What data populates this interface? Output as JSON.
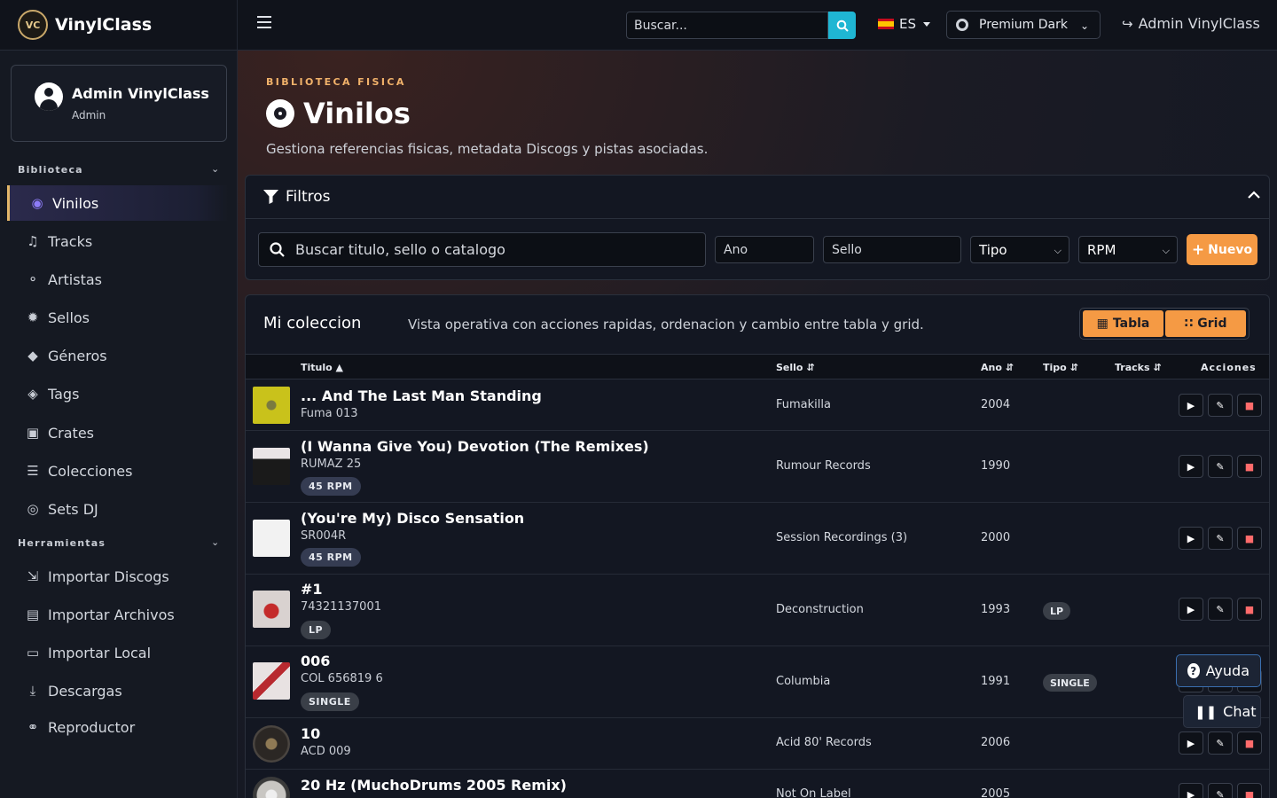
{
  "brand": {
    "logo_text": "VC",
    "name": "VinylClass"
  },
  "topbar": {
    "search_placeholder": "Buscar...",
    "language": "ES",
    "theme": "Premium Dark",
    "admin_label": "Admin VinylClass"
  },
  "sidebar": {
    "user": {
      "name": "Admin VinylClass",
      "role": "Admin"
    },
    "sections": [
      {
        "title": "Biblioteca",
        "items": [
          {
            "label": "Vinilos",
            "icon": "disc-icon",
            "active": true
          },
          {
            "label": "Tracks",
            "icon": "music-note-icon"
          },
          {
            "label": "Artistas",
            "icon": "microphone-icon"
          },
          {
            "label": "Sellos",
            "icon": "badge-icon"
          },
          {
            "label": "Géneros",
            "icon": "tag-icon"
          },
          {
            "label": "Tags",
            "icon": "tags-icon"
          },
          {
            "label": "Crates",
            "icon": "box-icon"
          },
          {
            "label": "Colecciones",
            "icon": "layers-icon"
          },
          {
            "label": "Sets DJ",
            "icon": "record-icon"
          }
        ]
      },
      {
        "title": "Herramientas",
        "items": [
          {
            "label": "Importar Discogs",
            "icon": "file-import-icon"
          },
          {
            "label": "Importar Archivos",
            "icon": "file-audio-icon"
          },
          {
            "label": "Importar Local",
            "icon": "folder-open-icon"
          },
          {
            "label": "Descargas",
            "icon": "download-icon"
          },
          {
            "label": "Reproductor",
            "icon": "headphones-icon"
          }
        ]
      }
    ]
  },
  "page": {
    "eyebrow": "BIBLIOTECA FISICA",
    "title": "Vinilos",
    "subtitle": "Gestiona referencias fisicas, metadata Discogs y pistas asociadas."
  },
  "filters": {
    "title": "Filtros",
    "search_placeholder": "Buscar titulo, sello o catalogo",
    "year_placeholder": "Ano",
    "label_placeholder": "Sello",
    "type_select": "Tipo",
    "rpm_select": "RPM",
    "new_button": "Nuevo"
  },
  "collection": {
    "title": "Mi coleccion",
    "description": "Vista operativa con acciones rapidas, ordenacion y cambio entre tabla y grid.",
    "view_table": "Tabla",
    "view_grid": "Grid",
    "columns": {
      "title": "Titulo",
      "label": "Sello",
      "year": "Ano",
      "type": "Tipo",
      "tracks": "Tracks",
      "actions": "Acciones"
    },
    "rows": [
      {
        "title": "... And The Last Man Standing",
        "catalog": "Fuma 013",
        "badge": "",
        "label": "Fumakilla",
        "year": "2004",
        "type": "",
        "thumb_color": "#c9c21b"
      },
      {
        "title": "(I Wanna Give You) Devotion (The Remixes)",
        "catalog": "RUMAZ 25",
        "badge": "45 RPM",
        "label": "Rumour Records",
        "year": "1990",
        "type": "",
        "thumb_color": "#e9e4e6"
      },
      {
        "title": "(You're My) Disco Sensation",
        "catalog": "SR004R",
        "badge": "45 RPM",
        "label": "Session Recordings (3)",
        "year": "2000",
        "type": "",
        "thumb_color": "#f2f2f2"
      },
      {
        "title": "#1",
        "catalog": "74321137001",
        "badge": "LP",
        "label": "Deconstruction",
        "year": "1993",
        "type": "LP",
        "thumb_color": "#d9d2d0"
      },
      {
        "title": "006",
        "catalog": "COL 656819 6",
        "badge": "SINGLE",
        "label": "Columbia",
        "year": "1991",
        "type": "SINGLE",
        "thumb_color": "#e8e2e2"
      },
      {
        "title": "10",
        "catalog": "ACD 009",
        "badge": "",
        "label": "Acid 80' Records",
        "year": "2006",
        "type": "",
        "thumb_color": "#2b2724"
      },
      {
        "title": "20 Hz (MuchoDrums 2005 Remix)",
        "catalog": "",
        "badge": "",
        "label": "Not On Label",
        "year": "2005",
        "type": "",
        "thumb_color": "#c8c6c2"
      }
    ]
  },
  "floating": {
    "help": "Ayuda",
    "chat": "Chat"
  }
}
